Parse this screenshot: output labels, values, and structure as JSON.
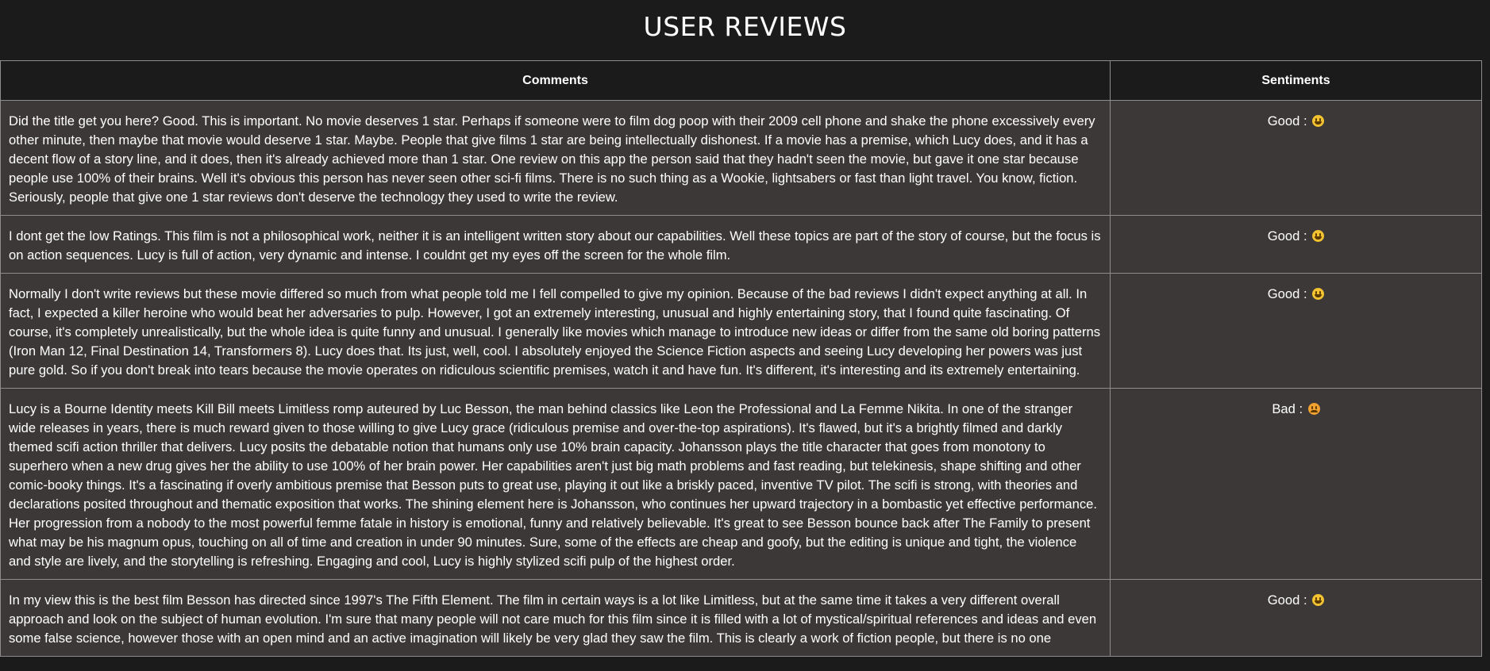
{
  "title": "USER REVIEWS",
  "headers": {
    "comments": "Comments",
    "sentiments": "Sentiments"
  },
  "rows": [
    {
      "comment": "Did the title get you here? Good. This is important. No movie deserves 1 star. Perhaps if someone were to film dog poop with their 2009 cell phone and shake the phone excessively every other minute, then maybe that movie would deserve 1 star. Maybe. People that give films 1 star are being intellectually dishonest. If a movie has a premise, which Lucy does, and it has a decent flow of a story line, and it does, then it's already achieved more than 1 star. One review on this app the person said that they hadn't seen the movie, but gave it one star because people use 100% of their brains. Well it's obvious this person has never seen other sci-fi films. There is no such thing as a Wookie, lightsabers or fast than light travel. You know, fiction. Seriously, people that give one 1 star reviews don't deserve the technology they used to write the review.",
      "sentiment": "Good :",
      "emoji": "grinning-face-icon"
    },
    {
      "comment": "I dont get the low Ratings. This film is not a philosophical work, neither it is an intelligent written story about our capabilities. Well these topics are part of the story of course, but the focus is on action sequences. Lucy is full of action, very dynamic and intense. I couldnt get my eyes off the screen for the whole film.",
      "sentiment": "Good :",
      "emoji": "grinning-face-icon"
    },
    {
      "comment": "Normally I don't write reviews but these movie differed so much from what people told me I fell compelled to give my opinion. Because of the bad reviews I didn't expect anything at all. In fact, I expected a killer heroine who would beat her adversaries to pulp. However, I got an extremely interesting, unusual and highly entertaining story, that I found quite fascinating. Of course, it's completely unrealistically, but the whole idea is quite funny and unusual. I generally like movies which manage to introduce new ideas or differ from the same old boring patterns (Iron Man 12, Final Destination 14, Transformers 8). Lucy does that. Its just, well, cool. I absolutely enjoyed the Science Fiction aspects and seeing Lucy developing her powers was just pure gold. So if you don't break into tears because the movie operates on ridiculous scientific premises, watch it and have fun. It's different, it's interesting and its extremely entertaining.",
      "sentiment": "Good :",
      "emoji": "grinning-face-icon"
    },
    {
      "comment": "Lucy is a Bourne Identity meets Kill Bill meets Limitless romp auteured by Luc Besson, the man behind classics like Leon the Professional and La Femme Nikita. In one of the stranger wide releases in years, there is much reward given to those willing to give Lucy grace (ridiculous premise and over-the-top aspirations). It's flawed, but it's a brightly filmed and darkly themed scifi action thriller that delivers. Lucy posits the debatable notion that humans only use 10% brain capacity. Johansson plays the title character that goes from monotony to superhero when a new drug gives her the ability to use 100% of her brain power. Her capabilities aren't just big math problems and fast reading, but telekinesis, shape shifting and other comic-booky things. It's a fascinating if overly ambitious premise that Besson puts to great use, playing it out like a briskly paced, inventive TV pilot. The scifi is strong, with theories and declarations posited throughout and thematic exposition that works. The shining element here is Johansson, who continues her upward trajectory in a bombastic yet effective performance. Her progression from a nobody to the most powerful femme fatale in history is emotional, funny and relatively believable. It's great to see Besson bounce back after The Family to present what may be his magnum opus, touching on all of time and creation in under 90 minutes. Sure, some of the effects are cheap and goofy, but the editing is unique and tight, the violence and style are lively, and the storytelling is refreshing. Engaging and cool, Lucy is highly stylized scifi pulp of the highest order.",
      "sentiment": "Bad :",
      "emoji": "persevering-face-icon"
    },
    {
      "comment": "In my view this is the best film Besson has directed since 1997's The Fifth Element. The film in certain ways is a lot like Limitless, but at the same time it takes a very different overall approach and look on the subject of human evolution. I'm sure that many people will not care much for this film since it is filled with a lot of mystical/spiritual references and ideas and even some false science, however those with an open mind and an active imagination will likely be very glad they saw the film. This is clearly a work of fiction people, but there is no one",
      "sentiment": "Good :",
      "emoji": "grinning-face-icon"
    }
  ]
}
